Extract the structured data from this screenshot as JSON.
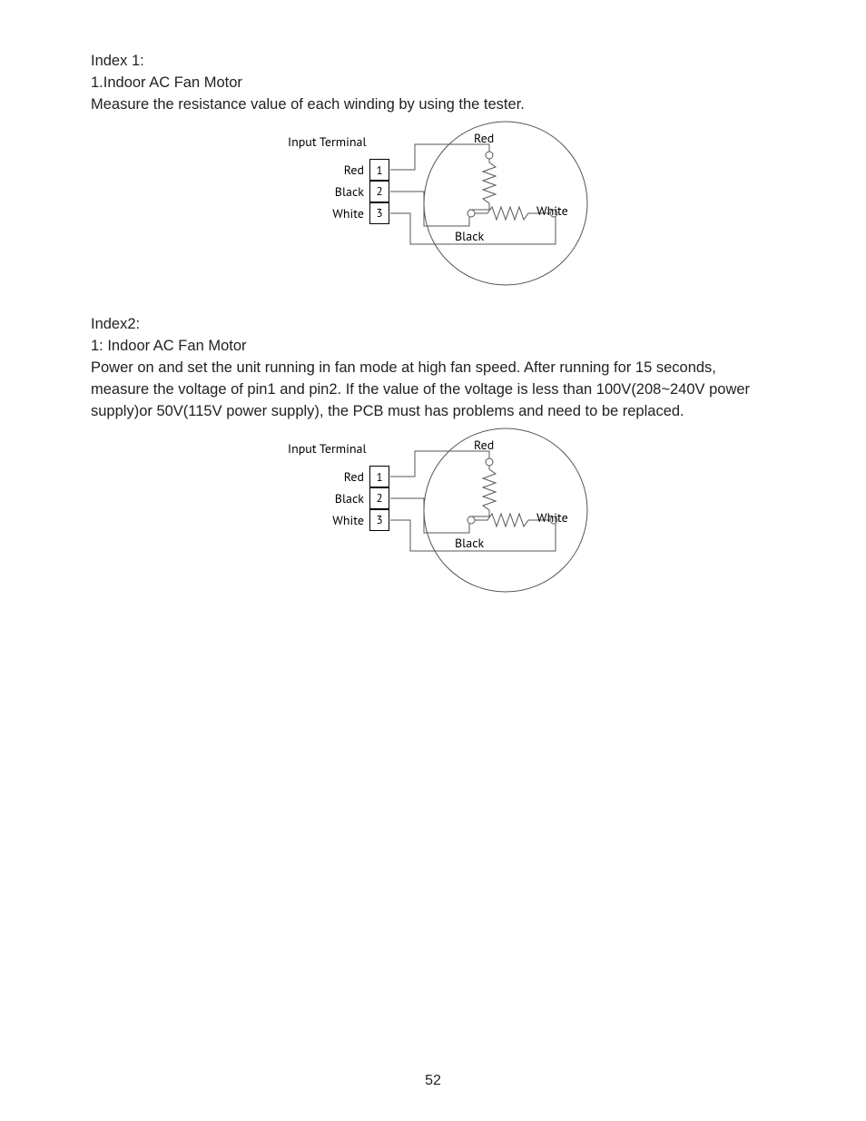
{
  "section1": {
    "heading": "Index 1:",
    "subheading": "1.Indoor AC Fan Motor",
    "instruction": "Measure the resistance value of each winding by using the tester."
  },
  "section2": {
    "heading": "Index2:",
    "subheading": "1: Indoor AC Fan Motor",
    "instruction_l1": "Power on and set the unit running in fan mode at high fan speed. After running for 15 seconds,",
    "instruction_l2": "measure the voltage of pin1 and pin2. If the value of the voltage is less than 100V(208~240V power",
    "instruction_l3": "supply)or 50V(115V power supply), the PCB must has problems and need to be replaced."
  },
  "diagram": {
    "input_terminal": "Input Terminal",
    "rows": [
      {
        "color": "Red",
        "num": "1"
      },
      {
        "color": "Black",
        "num": "2"
      },
      {
        "color": "White",
        "num": "3"
      }
    ],
    "dot_red": "Red",
    "dot_black": "Black",
    "dot_white": "White"
  },
  "page_number": "52"
}
